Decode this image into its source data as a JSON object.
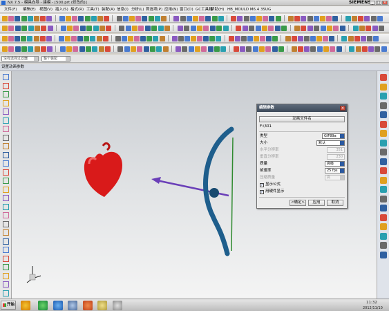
{
  "window": {
    "title": "NX 7.5 - 模具向导 - 建模 - [500.prt (修改的)]",
    "brand": "SIEMENS",
    "minimize": "_",
    "maximize": "□",
    "close": "×"
  },
  "menubar": {
    "items": [
      "文件(F)",
      "编辑(E)",
      "视图(V)",
      "插入(S)",
      "格式(R)",
      "工具(T)",
      "装配(A)",
      "信息(I)",
      "分析(L)",
      "首选项(P)",
      "应用(N)",
      "窗口(O)",
      "GC工具箱",
      "帮助(H)",
      "HB_MOULD M6.4",
      "3SUG"
    ]
  },
  "selection_bar": {
    "filter_placeholder": "没有选择过滤器",
    "scope_placeholder": "整个装配"
  },
  "viewport": {
    "title": "设置动画参数"
  },
  "dialog": {
    "title": "编辑参数",
    "filename_button": "动画文件名",
    "path": "F:\\301",
    "type_label": "类型",
    "type_value": "GIF89a",
    "size_label": "大小",
    "size_value": "默认",
    "hres_label": "水平分辨率",
    "hres_value": "351",
    "vres_label": "垂直分辨率",
    "vres_value": "230",
    "quality_label": "质量",
    "quality_value": "高级",
    "framerate_label": "帧速率",
    "framerate_value": "25 fps",
    "compression_label": "压缩质量",
    "compression_value": "高",
    "show_formula_label": "显示公式",
    "show_formula_checked": true,
    "show_hardware_label": "用硬件显示",
    "show_hardware_checked": true,
    "ok_label": "<确定>",
    "apply_label": "应用",
    "cancel_label": "取消"
  },
  "taskbar": {
    "start_label": "开始",
    "time": "11:32",
    "date": "2012/11/10"
  },
  "colors": {
    "heart": "#d91a1a",
    "bow": "#1e5e8c",
    "bowstring": "#2f8a2f",
    "arrow": "#6a3fb8",
    "dialog_title": "#4a5666"
  }
}
